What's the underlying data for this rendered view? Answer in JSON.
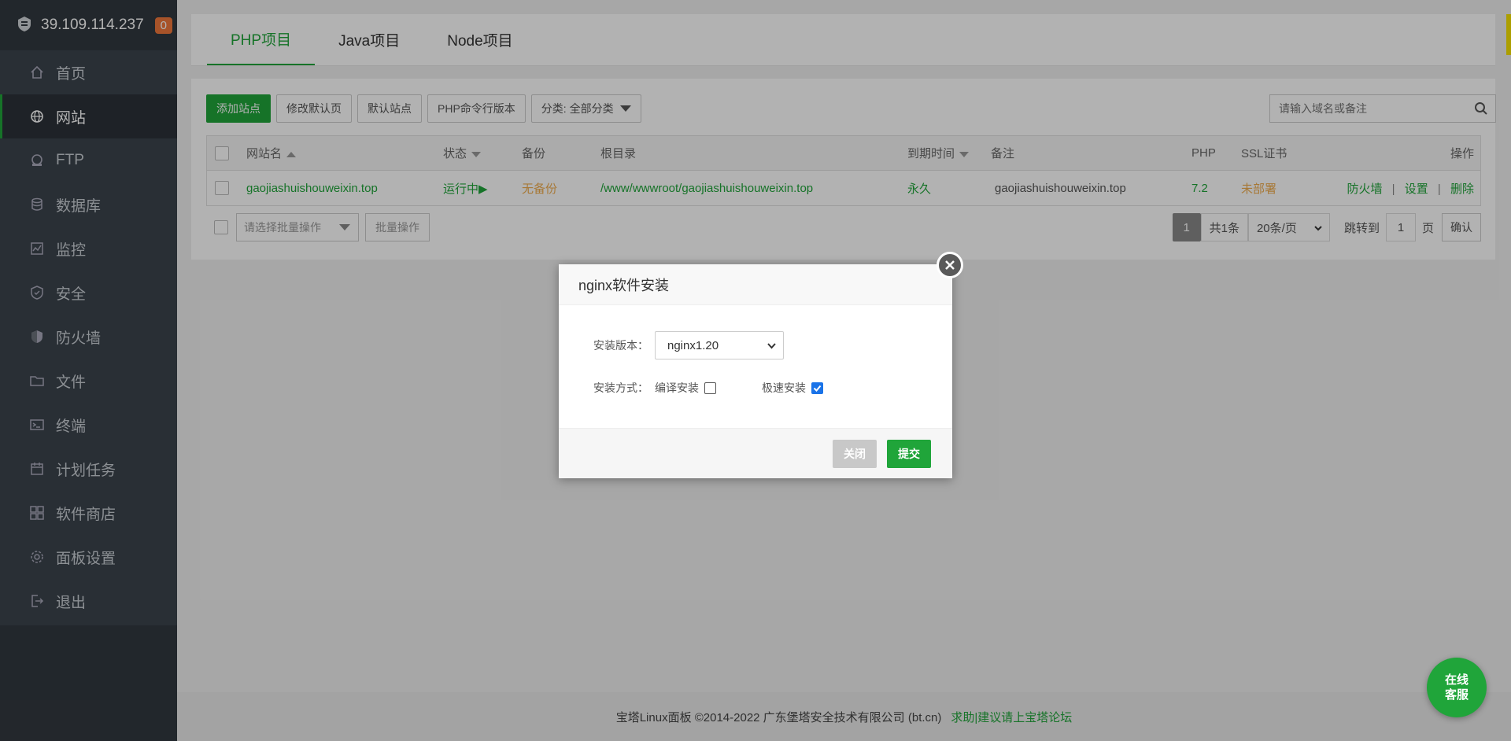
{
  "sidebar": {
    "host": "39.109.114.237",
    "badge": "0",
    "items": [
      {
        "label": "首页",
        "icon": "home-icon"
      },
      {
        "label": "网站",
        "icon": "globe-icon"
      },
      {
        "label": "FTP",
        "icon": "ftp-icon"
      },
      {
        "label": "数据库",
        "icon": "database-icon"
      },
      {
        "label": "监控",
        "icon": "monitor-icon"
      },
      {
        "label": "安全",
        "icon": "shield-check-icon"
      },
      {
        "label": "防火墙",
        "icon": "shield-icon"
      },
      {
        "label": "文件",
        "icon": "folder-icon"
      },
      {
        "label": "终端",
        "icon": "terminal-icon"
      },
      {
        "label": "计划任务",
        "icon": "calendar-icon"
      },
      {
        "label": "软件商店",
        "icon": "apps-icon"
      },
      {
        "label": "面板设置",
        "icon": "gear-icon"
      },
      {
        "label": "退出",
        "icon": "logout-icon"
      }
    ]
  },
  "tabs": [
    "PHP项目",
    "Java项目",
    "Node项目"
  ],
  "toolbar": {
    "add_site": "添加站点",
    "edit_default": "修改默认页",
    "default_site": "默认站点",
    "php_cli": "PHP命令行版本",
    "category": "分类: 全部分类",
    "search_placeholder": "请输入域名或备注"
  },
  "table": {
    "headers": {
      "name": "网站名",
      "status": "状态",
      "backup": "备份",
      "root": "根目录",
      "expire": "到期时间",
      "remark": "备注",
      "php": "PHP",
      "ssl": "SSL证书",
      "ops": "操作"
    },
    "rows": [
      {
        "name": "gaojiashuishouweixin.top",
        "status": "运行中▶",
        "backup": "无备份",
        "root": "/www/wwwroot/gaojiashuishouweixin.top",
        "expire": "永久",
        "remark": "gaojiashuishouweixin.top",
        "php": "7.2",
        "ssl": "未部署",
        "op_firewall": "防火墙",
        "op_settings": "设置",
        "op_delete": "删除",
        "sep": "|"
      }
    ]
  },
  "batch": {
    "select_placeholder": "请选择批量操作",
    "button": "批量操作"
  },
  "pager": {
    "current": "1",
    "total": "共1条",
    "per_page": "20条/页",
    "jump_label": "跳转到",
    "jump_value": "1",
    "page_unit": "页",
    "confirm": "确认"
  },
  "footer": {
    "copyright": "宝塔Linux面板 ©2014-2022 广东堡塔安全技术有限公司 (bt.cn)",
    "link": "求助|建议请上宝塔论坛"
  },
  "modal": {
    "title": "nginx软件安装",
    "version_label": "安装版本：",
    "version_value": "nginx1.20",
    "method_label": "安装方式：",
    "option_compile": "编译安装",
    "option_fast": "极速安装",
    "compile_checked": false,
    "fast_checked": true,
    "close": "关闭",
    "submit": "提交"
  },
  "chat": {
    "line1": "在线",
    "line2": "客服"
  },
  "colors": {
    "accent": "#20a53a",
    "sidebar": "#3c444d",
    "badge": "#f0773c",
    "warning": "#f0ad4e"
  }
}
